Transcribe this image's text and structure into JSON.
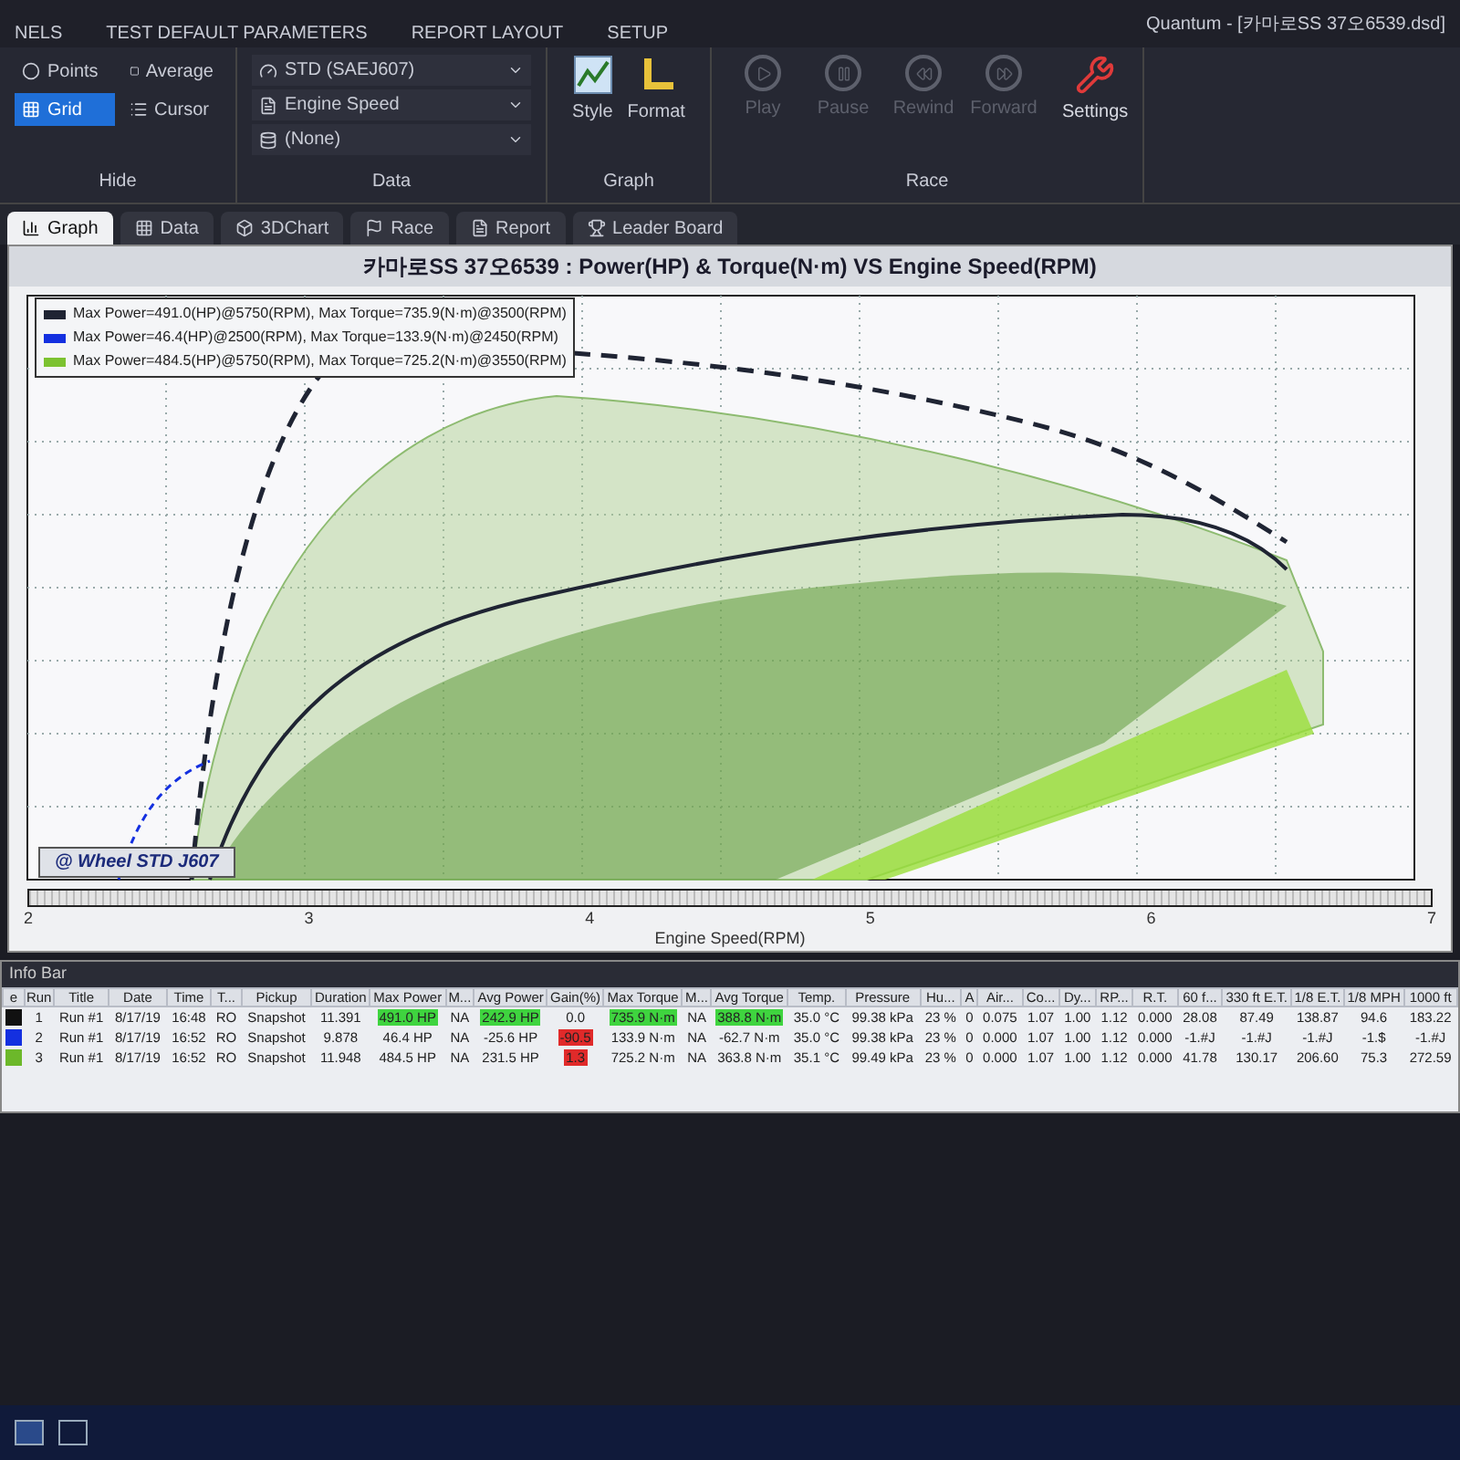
{
  "window": {
    "title": "Quantum - [카마로SS 37오6539.dsd]"
  },
  "ribbon_tabs": [
    "NELS",
    "TEST DEFAULT PARAMETERS",
    "REPORT LAYOUT",
    "SETUP"
  ],
  "ribbon": {
    "hide": {
      "label": "Hide",
      "items": [
        {
          "label": "Points",
          "selected": false
        },
        {
          "label": "Average",
          "selected": false
        },
        {
          "label": "Grid",
          "selected": true
        },
        {
          "label": "Cursor",
          "selected": false
        }
      ]
    },
    "data": {
      "label": "Data",
      "dropdowns": [
        "STD (SAEJ607)",
        "Engine Speed",
        "(None)"
      ]
    },
    "graph": {
      "label": "Graph",
      "buttons": [
        "Style",
        "Format"
      ]
    },
    "race": {
      "label": "Race",
      "buttons": [
        {
          "label": "Play",
          "disabled": true
        },
        {
          "label": "Pause",
          "disabled": true
        },
        {
          "label": "Rewind",
          "disabled": true
        },
        {
          "label": "Forward",
          "disabled": true
        }
      ],
      "settings": "Settings"
    }
  },
  "doc_tabs": [
    {
      "label": "Graph",
      "selected": true
    },
    {
      "label": "Data",
      "selected": false
    },
    {
      "label": "3DChart",
      "selected": false
    },
    {
      "label": "Race",
      "selected": false
    },
    {
      "label": "Report",
      "selected": false
    },
    {
      "label": "Leader Board",
      "selected": false
    }
  ],
  "chart": {
    "title": "카마로SS 37오6539 : Power(HP) & Torque(N·m) VS Engine Speed(RPM)",
    "legend": [
      {
        "text": "Max Power=491.0(HP)@5750(RPM), Max Torque=735.9(N·m)@3500(RPM)",
        "color": "#1f2433"
      },
      {
        "text": "Max Power=46.4(HP)@2500(RPM), Max Torque=133.9(N·m)@2450(RPM)",
        "color": "#1430e0"
      },
      {
        "text": "Max Power=484.5(HP)@5750(RPM), Max Torque=725.2(N·m)@3550(RPM)",
        "color": "#7cc230"
      }
    ],
    "note": "@ Wheel STD J607",
    "xticks": [
      "2",
      "3",
      "4",
      "5",
      "6",
      "7"
    ],
    "xlabel": "Engine Speed(RPM)"
  },
  "info_bar": {
    "title": "Info Bar",
    "columns": [
      "e",
      "Run",
      "Title",
      "Date",
      "Time",
      "T...",
      "Pickup",
      "Duration",
      "Max Power",
      "M...",
      "Avg Power",
      "Gain(%)",
      "Max Torque",
      "M...",
      "Avg Torque",
      "Temp.",
      "Pressure",
      "Hu...",
      "A",
      "Air...",
      "Co...",
      "Dy...",
      "RP...",
      "R.T.",
      "60 f...",
      "330 ft E.T.",
      "1/8 E.T.",
      "1/8 MPH",
      "1000 ft"
    ],
    "rows": [
      {
        "color": "#111111",
        "cells": [
          "",
          "1",
          "Run #1",
          "8/17/19",
          "16:48",
          "RO",
          "Snapshot",
          "11.391",
          {
            "text": "491.0 HP",
            "color": "#3fd43f"
          },
          "NA",
          {
            "text": "242.9 HP",
            "color": "#3fd43f"
          },
          "0.0",
          {
            "text": "735.9 N·m",
            "color": "#3fd43f"
          },
          "NA",
          {
            "text": "388.8 N·m",
            "color": "#3fd43f"
          },
          "35.0 °C",
          "99.38 kPa",
          "23 %",
          "0",
          "0.075",
          "1.07",
          "1.00",
          "1.12",
          "0.000",
          "28.08",
          "87.49",
          "138.87",
          "94.6",
          "183.22"
        ]
      },
      {
        "color": "#1430e0",
        "cells": [
          "",
          "2",
          "Run #1",
          "8/17/19",
          "16:52",
          "RO",
          "Snapshot",
          "9.878",
          "46.4 HP",
          "NA",
          "-25.6 HP",
          {
            "text": "-90.5",
            "color": "#e02a2a"
          },
          "133.9 N·m",
          "NA",
          "-62.7 N·m",
          "35.0 °C",
          "99.38 kPa",
          "23 %",
          "0",
          "0.000",
          "1.07",
          "1.00",
          "1.12",
          "0.000",
          "-1.#J",
          "-1.#J",
          "-1.#J",
          "-1.$",
          "-1.#J"
        ]
      },
      {
        "color": "#6cb82a",
        "cells": [
          "",
          "3",
          "Run #1",
          "8/17/19",
          "16:52",
          "RO",
          "Snapshot",
          "11.948",
          "484.5 HP",
          "NA",
          "231.5 HP",
          {
            "text": "1.3",
            "color": "#e02a2a"
          },
          "725.2 N·m",
          "NA",
          "363.8 N·m",
          "35.1 °C",
          "99.49 kPa",
          "23 %",
          "0",
          "0.000",
          "1.07",
          "1.00",
          "1.12",
          "0.000",
          "41.78",
          "130.17",
          "206.60",
          "75.3",
          "272.59"
        ]
      }
    ]
  }
}
